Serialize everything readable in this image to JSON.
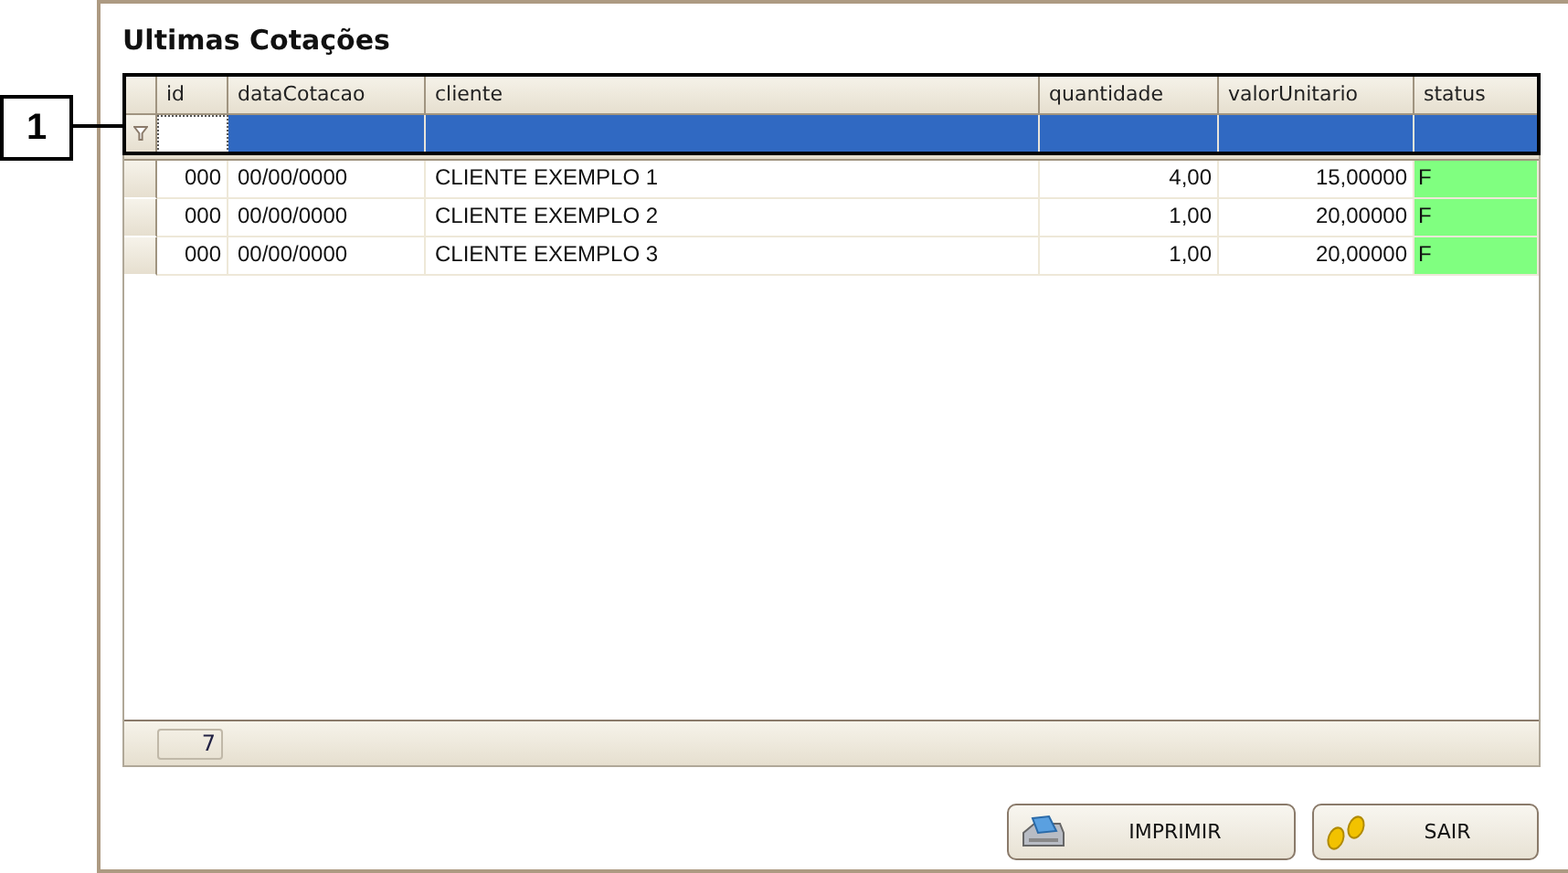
{
  "title": "Ultimas Cotações",
  "callout": "1",
  "columns": [
    "id",
    "dataCotacao",
    "cliente",
    "quantidade",
    "valorUnitario",
    "status"
  ],
  "rows": [
    {
      "cells": [
        "000",
        "00/00/0000",
        "CLIENTE EXEMPLO 1",
        "4,00",
        "15,00000",
        "F"
      ]
    },
    {
      "cells": [
        "000",
        "00/00/0000",
        "CLIENTE EXEMPLO 2",
        "1,00",
        "20,00000",
        "F"
      ]
    },
    {
      "cells": [
        "000",
        "00/00/0000",
        "CLIENTE EXEMPLO 3",
        "1,00",
        "20,00000",
        "F"
      ]
    }
  ],
  "footer_count": "7",
  "buttons": [
    {
      "label": "IMPRIMIR",
      "kind": "print"
    },
    {
      "label": "SAIR",
      "kind": "exit"
    }
  ]
}
